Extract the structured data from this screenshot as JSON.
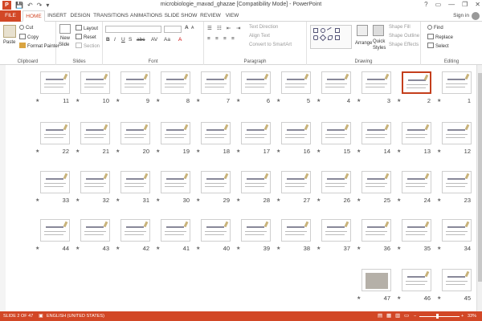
{
  "window": {
    "title": "microbiologie_mavad_ghazae [Compatibility Mode] - PowerPoint",
    "controls": [
      "?",
      "▭",
      "—",
      "❐",
      "✕"
    ]
  },
  "qat": [
    "💾",
    "↶",
    "↷",
    "▾"
  ],
  "app_logo": "P",
  "tabs": [
    {
      "label": "FILE"
    },
    {
      "label": "HOME"
    },
    {
      "label": "INSERT"
    },
    {
      "label": "DESIGN"
    },
    {
      "label": "TRANSITIONS"
    },
    {
      "label": "ANIMATIONS"
    },
    {
      "label": "SLIDE SHOW"
    },
    {
      "label": "REVIEW"
    },
    {
      "label": "VIEW"
    }
  ],
  "signin": "Sign in",
  "ribbon": {
    "clipboard": {
      "label": "Clipboard",
      "paste": "Paste",
      "cut": "Cut",
      "copy": "Copy",
      "format_painter": "Format Painter"
    },
    "slides": {
      "label": "Slides",
      "new_slide": "New",
      "new_slide2": "Slide",
      "layout": "Layout",
      "reset": "Reset",
      "section": "Section"
    },
    "font": {
      "label": "Font"
    },
    "paragraph": {
      "label": "Paragraph",
      "text_direction": "Text Direction",
      "align_text": "Align Text",
      "convert": "Convert to SmartArt"
    },
    "drawing": {
      "label": "Drawing",
      "arrange": "Arrange",
      "quick_styles": "Quick",
      "quick_styles2": "Styles",
      "shape_fill": "Shape Fill",
      "shape_outline": "Shape Outline",
      "shape_effects": "Shape Effects"
    },
    "editing": {
      "label": "Editing",
      "find": "Find",
      "replace": "Replace",
      "select": "Select"
    }
  },
  "slides": [
    {
      "n": "1"
    },
    {
      "n": "2"
    },
    {
      "n": "3"
    },
    {
      "n": "4"
    },
    {
      "n": "5"
    },
    {
      "n": "6"
    },
    {
      "n": "7"
    },
    {
      "n": "8"
    },
    {
      "n": "9"
    },
    {
      "n": "10"
    },
    {
      "n": "11"
    },
    {
      "n": "12"
    },
    {
      "n": "13"
    },
    {
      "n": "14"
    },
    {
      "n": "15"
    },
    {
      "n": "16"
    },
    {
      "n": "17"
    },
    {
      "n": "18"
    },
    {
      "n": "19"
    },
    {
      "n": "20"
    },
    {
      "n": "21"
    },
    {
      "n": "22"
    },
    {
      "n": "23"
    },
    {
      "n": "24"
    },
    {
      "n": "25"
    },
    {
      "n": "26"
    },
    {
      "n": "27"
    },
    {
      "n": "28"
    },
    {
      "n": "29"
    },
    {
      "n": "30"
    },
    {
      "n": "31"
    },
    {
      "n": "32"
    },
    {
      "n": "33"
    },
    {
      "n": "34"
    },
    {
      "n": "35"
    },
    {
      "n": "36"
    },
    {
      "n": "37"
    },
    {
      "n": "38"
    },
    {
      "n": "39"
    },
    {
      "n": "40"
    },
    {
      "n": "41"
    },
    {
      "n": "42"
    },
    {
      "n": "43"
    },
    {
      "n": "44"
    },
    {
      "n": "45"
    },
    {
      "n": "46"
    },
    {
      "n": "47"
    }
  ],
  "star_glyph": "★",
  "statusbar": {
    "slide_info": "SLIDE 2 OF 47",
    "language": "ENGLISH (UNITED STATES)",
    "zoom": "33%",
    "zoom_minus": "−",
    "zoom_plus": "+"
  },
  "colors": {
    "accent": "#d24726",
    "selected_border": "#c43e1c"
  }
}
